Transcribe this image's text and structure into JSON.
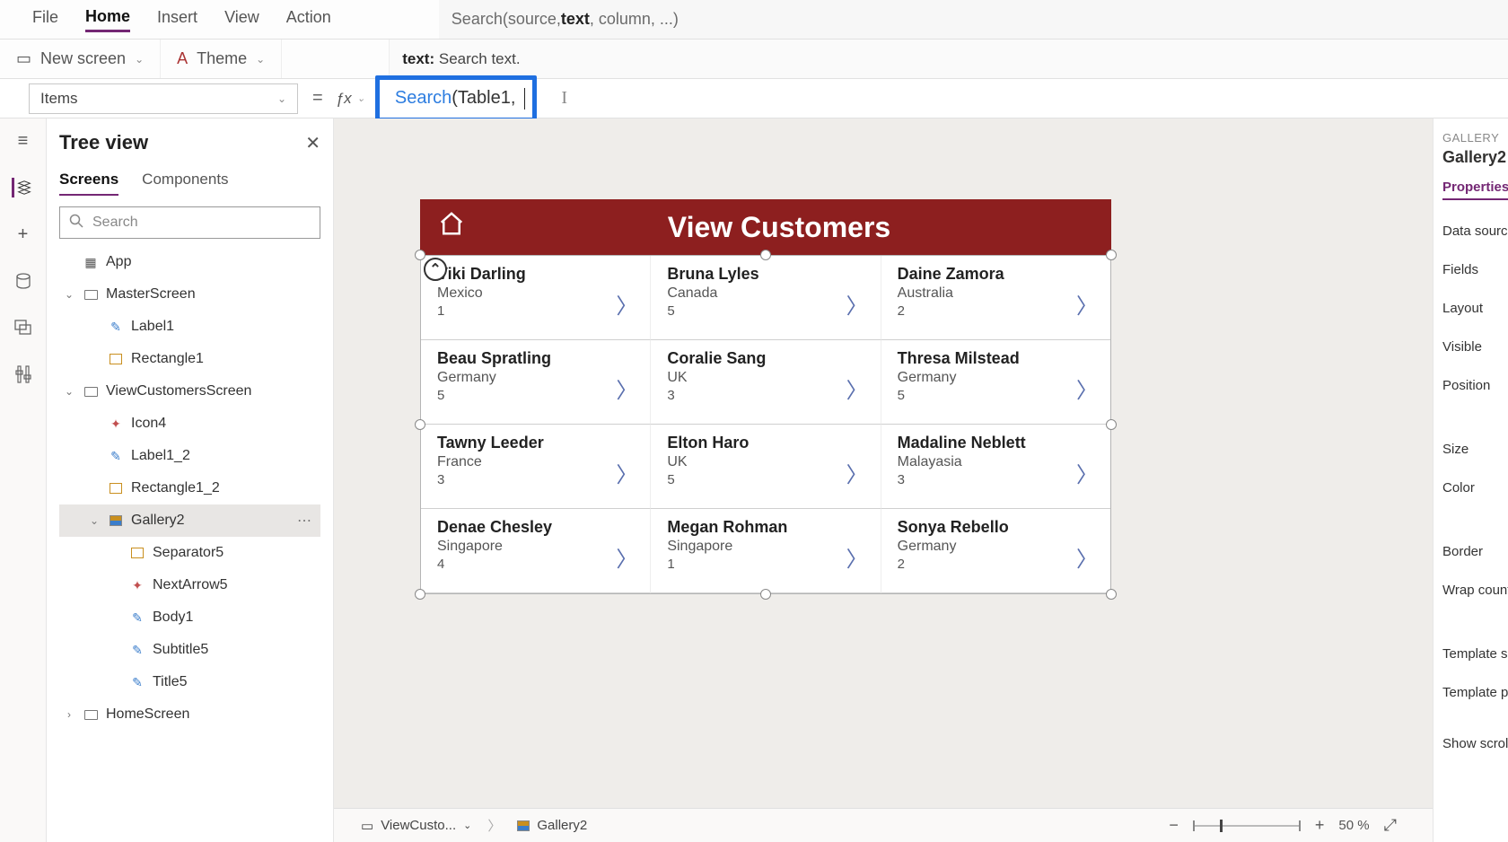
{
  "ribbon": {
    "tabs": [
      "File",
      "Home",
      "Insert",
      "View",
      "Action"
    ],
    "active": "Home",
    "new_screen": "New screen",
    "theme": "Theme"
  },
  "formula": {
    "hint_pre": "Search(source, ",
    "hint_bold": "text",
    "hint_post": ", column, ...)",
    "param_label": "text:",
    "param_desc": "Search text.",
    "fn": "Search",
    "args": "(Table1, ",
    "prop_selector": "Items"
  },
  "tree": {
    "title": "Tree view",
    "tabs": {
      "screens": "Screens",
      "components": "Components"
    },
    "search_placeholder": "Search",
    "items": [
      {
        "label": "App",
        "icon": "app",
        "depth": 0,
        "exp": ""
      },
      {
        "label": "MasterScreen",
        "icon": "screen",
        "depth": 0,
        "exp": "v"
      },
      {
        "label": "Label1",
        "icon": "label",
        "depth": 1
      },
      {
        "label": "Rectangle1",
        "icon": "rect",
        "depth": 1
      },
      {
        "label": "ViewCustomersScreen",
        "icon": "screen",
        "depth": 0,
        "exp": "v"
      },
      {
        "label": "Icon4",
        "icon": "icons",
        "depth": 1
      },
      {
        "label": "Label1_2",
        "icon": "label",
        "depth": 1
      },
      {
        "label": "Rectangle1_2",
        "icon": "rect",
        "depth": 1
      },
      {
        "label": "Gallery2",
        "icon": "gallery",
        "depth": 1,
        "exp": "v",
        "sel": true,
        "dots": true
      },
      {
        "label": "Separator5",
        "icon": "rect",
        "depth": 2
      },
      {
        "label": "NextArrow5",
        "icon": "icons",
        "depth": 2
      },
      {
        "label": "Body1",
        "icon": "label",
        "depth": 2
      },
      {
        "label": "Subtitle5",
        "icon": "label",
        "depth": 2
      },
      {
        "label": "Title5",
        "icon": "label",
        "depth": 2
      },
      {
        "label": "HomeScreen",
        "icon": "screen",
        "depth": 0,
        "exp": ">"
      }
    ]
  },
  "canvas": {
    "header_title": "View Customers",
    "rows": [
      [
        {
          "name": "Viki  Darling",
          "sub": "Mexico",
          "num": "1"
        },
        {
          "name": "Bruna  Lyles",
          "sub": "Canada",
          "num": "5"
        },
        {
          "name": "Daine  Zamora",
          "sub": "Australia",
          "num": "2"
        }
      ],
      [
        {
          "name": "Beau  Spratling",
          "sub": "Germany",
          "num": "5"
        },
        {
          "name": "Coralie  Sang",
          "sub": "UK",
          "num": "3"
        },
        {
          "name": "Thresa  Milstead",
          "sub": "Germany",
          "num": "5"
        }
      ],
      [
        {
          "name": "Tawny  Leeder",
          "sub": "France",
          "num": "3"
        },
        {
          "name": "Elton  Haro",
          "sub": "UK",
          "num": "5"
        },
        {
          "name": "Madaline  Neblett",
          "sub": "Malayasia",
          "num": "3"
        }
      ],
      [
        {
          "name": "Denae  Chesley",
          "sub": "Singapore",
          "num": "4"
        },
        {
          "name": "Megan  Rohman",
          "sub": "Singapore",
          "num": "1"
        },
        {
          "name": "Sonya  Rebello",
          "sub": "Germany",
          "num": "2"
        }
      ]
    ]
  },
  "breadcrumb": {
    "screen": "ViewCusto...",
    "gallery": "Gallery2",
    "zoom": "50 %",
    "show_scroll": "Show scroll"
  },
  "props": {
    "type": "GALLERY",
    "name": "Gallery2",
    "tab": "Properties",
    "rows": [
      "Data source",
      "Fields",
      "Layout",
      "Visible",
      "Position",
      "Size",
      "Color",
      "Border",
      "Wrap count",
      "Template size",
      "Template pad"
    ]
  }
}
